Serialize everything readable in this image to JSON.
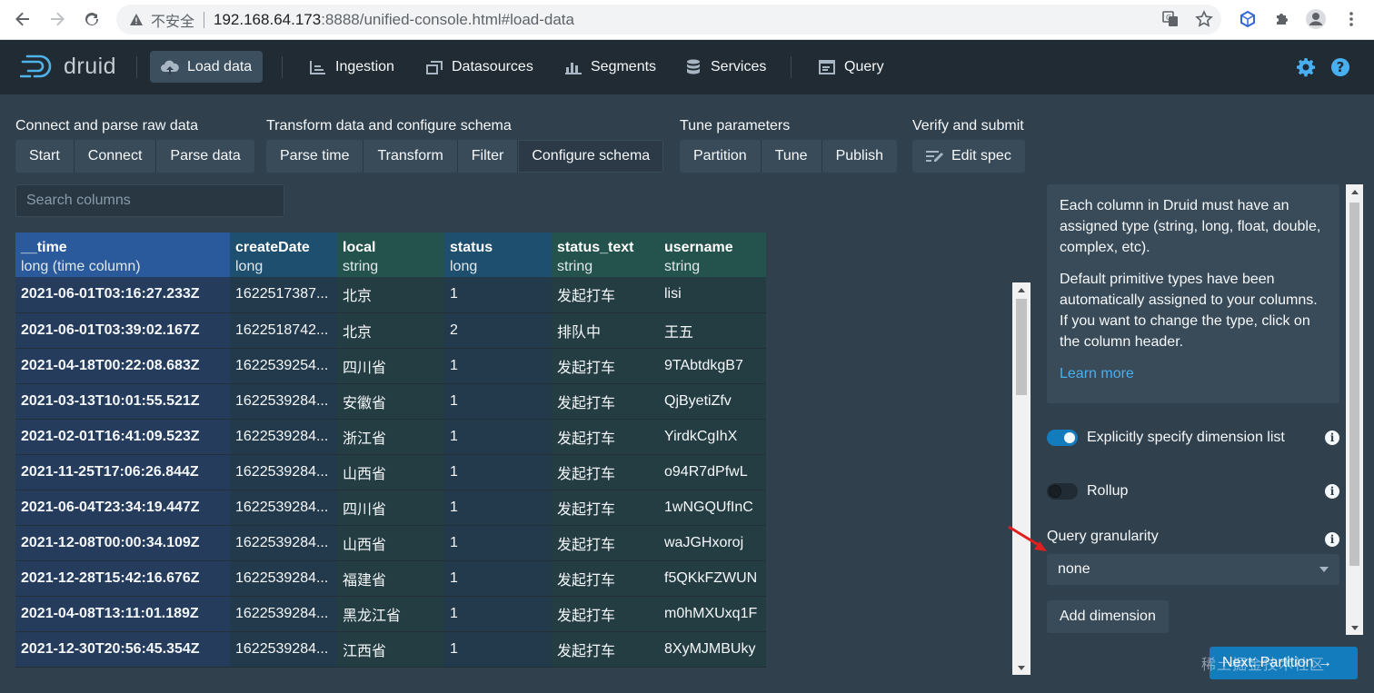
{
  "browser": {
    "insecure_label": "不安全",
    "url_host": "192.168.64.173",
    "url_rest": ":8888/unified-console.html#load-data"
  },
  "header": {
    "logo_text": "druid",
    "nav": [
      {
        "label": "Load data",
        "icon": "cloud-upload-icon",
        "active": true
      },
      {
        "label": "Ingestion",
        "icon": "chart-icon"
      },
      {
        "label": "Datasources",
        "icon": "multi-select-icon"
      },
      {
        "label": "Segments",
        "icon": "stacked-chart-icon"
      },
      {
        "label": "Services",
        "icon": "database-icon"
      },
      {
        "label": "Query",
        "icon": "application-icon"
      }
    ]
  },
  "steps": {
    "groups": [
      {
        "title": "Connect and parse raw data",
        "buttons": [
          "Start",
          "Connect",
          "Parse data"
        ]
      },
      {
        "title": "Transform data and configure schema",
        "buttons": [
          "Parse time",
          "Transform",
          "Filter",
          "Configure schema"
        ]
      },
      {
        "title": "Tune parameters",
        "buttons": [
          "Partition",
          "Tune",
          "Publish"
        ]
      },
      {
        "title": "Verify and submit",
        "buttons": [
          "Edit spec"
        ]
      }
    ],
    "current": "Configure schema"
  },
  "search": {
    "placeholder": "Search columns"
  },
  "table": {
    "columns": [
      {
        "name": "__time",
        "type": "long (time column)"
      },
      {
        "name": "createDate",
        "type": "long"
      },
      {
        "name": "local",
        "type": "string"
      },
      {
        "name": "status",
        "type": "long"
      },
      {
        "name": "status_text",
        "type": "string"
      },
      {
        "name": "username",
        "type": "string"
      }
    ],
    "rows": [
      [
        "2021-06-01T03:16:27.233Z",
        "1622517387...",
        "北京",
        "1",
        "发起打车",
        "lisi"
      ],
      [
        "2021-06-01T03:39:02.167Z",
        "1622518742...",
        "北京",
        "2",
        "排队中",
        "王五"
      ],
      [
        "2021-04-18T00:22:08.683Z",
        "1622539254...",
        "四川省",
        "1",
        "发起打车",
        "9TAbtdkgB7"
      ],
      [
        "2021-03-13T10:01:55.521Z",
        "1622539284...",
        "安徽省",
        "1",
        "发起打车",
        "QjByetiZfv"
      ],
      [
        "2021-02-01T16:41:09.523Z",
        "1622539284...",
        "浙江省",
        "1",
        "发起打车",
        "YirdkCgIhX"
      ],
      [
        "2021-11-25T17:06:26.844Z",
        "1622539284...",
        "山西省",
        "1",
        "发起打车",
        "o94R7dPfwL"
      ],
      [
        "2021-06-04T23:34:19.447Z",
        "1622539284...",
        "四川省",
        "1",
        "发起打车",
        "1wNGQUfInC"
      ],
      [
        "2021-12-08T00:00:34.109Z",
        "1622539284...",
        "山西省",
        "1",
        "发起打车",
        "waJGHxoroj"
      ],
      [
        "2021-12-28T15:42:16.676Z",
        "1622539284...",
        "福建省",
        "1",
        "发起打车",
        "f5QKkFZWUN"
      ],
      [
        "2021-04-08T13:11:01.189Z",
        "1622539284...",
        "黑龙江省",
        "1",
        "发起打车",
        "m0hMXUxq1F"
      ],
      [
        "2021-12-30T20:56:45.354Z",
        "1622539284...",
        "江西省",
        "1",
        "发起打车",
        "8XyMJMBUky"
      ]
    ]
  },
  "panel": {
    "info_p1": "Each column in Druid must have an assigned type (string, long, float, double, complex, etc).",
    "info_p2": "Default primitive types have been automatically assigned to your columns. If you want to change the type, click on the column header.",
    "learn_more": "Learn more",
    "explicit_dimensions_label": "Explicitly specify dimension list",
    "explicit_dimensions_on": true,
    "rollup_label": "Rollup",
    "rollup_on": false,
    "query_granularity_label": "Query granularity",
    "query_granularity_value": "none",
    "add_dimension": "Add dimension",
    "next_button": "Next: Partition →"
  },
  "watermark": "稀土掘金技术社区",
  "colors": {
    "accent": "#137cbd",
    "link": "#48aff0",
    "background": "#30404d",
    "header": "#202b33",
    "annotation_arrow": "#e02020"
  }
}
